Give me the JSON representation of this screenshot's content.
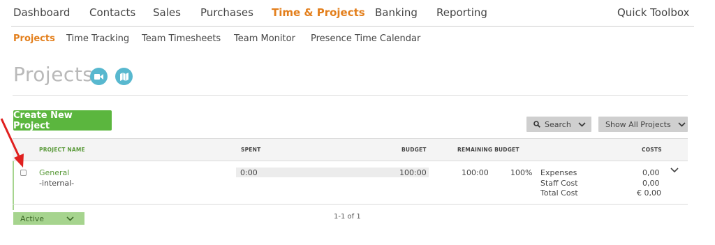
{
  "topnav": {
    "items": [
      "Dashboard",
      "Contacts",
      "Sales",
      "Purchases",
      "Time & Projects",
      "Banking",
      "Reporting"
    ],
    "toolbox": "Quick Toolbox"
  },
  "subnav": {
    "items": [
      "Projects",
      "Time Tracking",
      "Team Timesheets",
      "Team Monitor",
      "Presence Time Calendar"
    ]
  },
  "page": {
    "title": "Projects",
    "icons": [
      "video-icon",
      "map-icon"
    ]
  },
  "toolbar": {
    "create_label": "Create New Project",
    "search_label": "Search",
    "filter_label": "Show All Projects"
  },
  "table": {
    "headers": {
      "project_name": "PROJECT NAME",
      "spent": "SPENT",
      "budget": "BUDGET",
      "remaining_budget": "REMAINING BUDGET",
      "costs": "COSTS"
    },
    "rows": [
      {
        "name": "General",
        "client": "-internal-",
        "spent": "0:00",
        "budget": "100:00",
        "remaining": "100:00",
        "remaining_pct": "100%",
        "expenses_label": "Expenses",
        "expenses_value": "0,00",
        "staff_label": "Staff Cost",
        "staff_value": "0,00",
        "total_label": "Total Cost",
        "total_value": "€ 0,00"
      }
    ]
  },
  "footer": {
    "status_select": "Active",
    "pagination": "1-1 of 1"
  },
  "colors": {
    "accent_orange": "#e37f1c",
    "green": "#5bb63e",
    "light_green": "#a6d48e",
    "icon_blue": "#58b8cf",
    "annotation_red": "#e0201f"
  }
}
